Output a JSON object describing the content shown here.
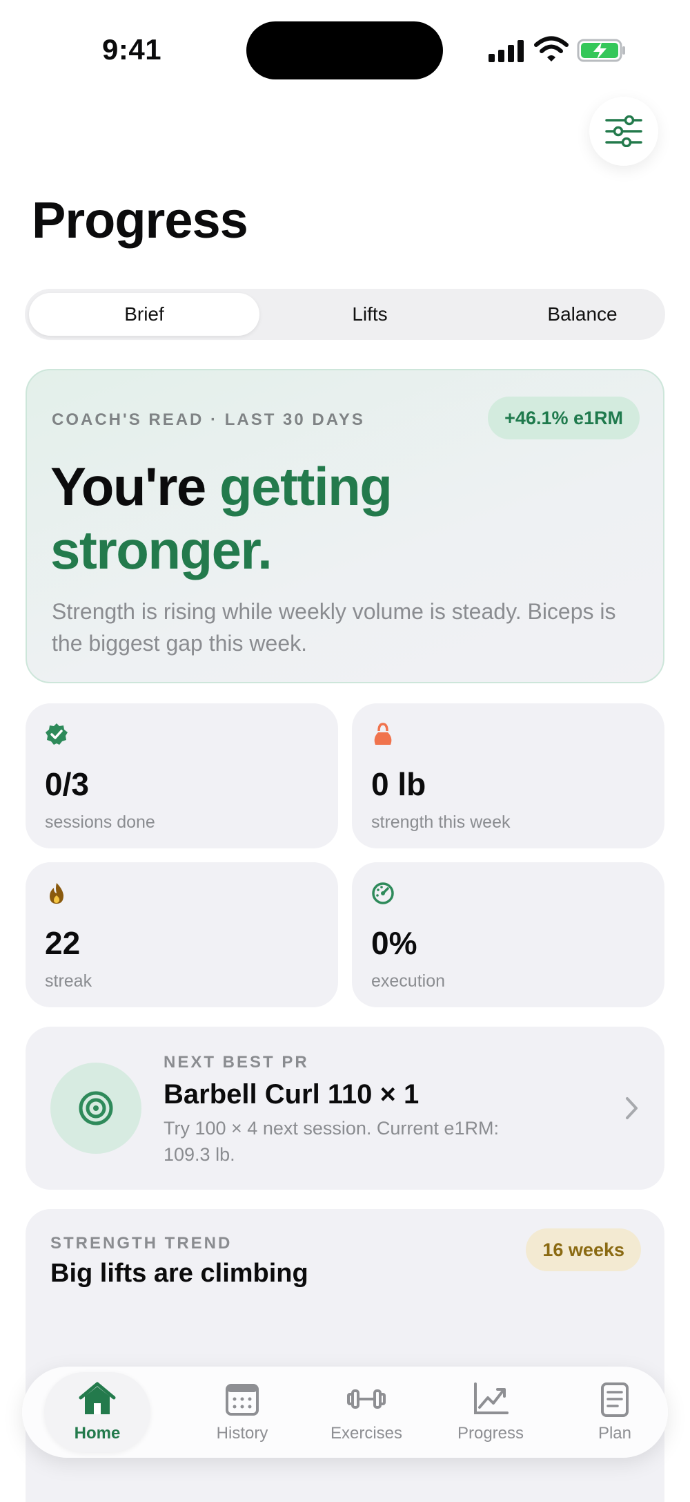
{
  "status_bar": {
    "time": "9:41"
  },
  "header": {
    "title": "Progress"
  },
  "segments": [
    {
      "label": "Brief",
      "selected": true
    },
    {
      "label": "Lifts",
      "selected": false
    },
    {
      "label": "Balance",
      "selected": false
    }
  ],
  "coach": {
    "eyebrow": "COACH'S READ · LAST 30 DAYS",
    "badge": "+46.1% e1RM",
    "headline_prefix": "You're",
    "headline_accent": "getting stronger.",
    "body": "Strength is rising while weekly volume is steady. Biceps is the biggest gap this week."
  },
  "stats": [
    {
      "icon": "verified-badge-icon",
      "value": "0/3",
      "label": "sessions done",
      "color": "#2e8a5a"
    },
    {
      "icon": "kettlebell-icon",
      "value": "0 lb",
      "label": "strength this week",
      "color": "#f0734d"
    },
    {
      "icon": "flame-icon",
      "value": "22",
      "label": "streak",
      "color": "#8a5a0e"
    },
    {
      "icon": "gauge-icon",
      "value": "0%",
      "label": "execution",
      "color": "#2e8a5a"
    }
  ],
  "next_pr": {
    "eyebrow": "NEXT BEST PR",
    "title": "Barbell Curl 110 × 1",
    "description": "Try 100 × 4 next session. Current e1RM: 109.3 lb."
  },
  "trend": {
    "eyebrow": "STRENGTH TREND",
    "title": "Big lifts are climbing",
    "badge": "16 weeks"
  },
  "tabs": [
    {
      "label": "Home",
      "icon": "house-icon",
      "active": true
    },
    {
      "label": "History",
      "icon": "calendar-icon",
      "active": false
    },
    {
      "label": "Exercises",
      "icon": "dumbbell-icon",
      "active": false
    },
    {
      "label": "Progress",
      "icon": "chart-icon",
      "active": false
    },
    {
      "label": "Plan",
      "icon": "notepad-icon",
      "active": false
    }
  ],
  "colors": {
    "accent": "#237a4c",
    "muted": "#8a8c90",
    "card": "#f1f1f5"
  }
}
